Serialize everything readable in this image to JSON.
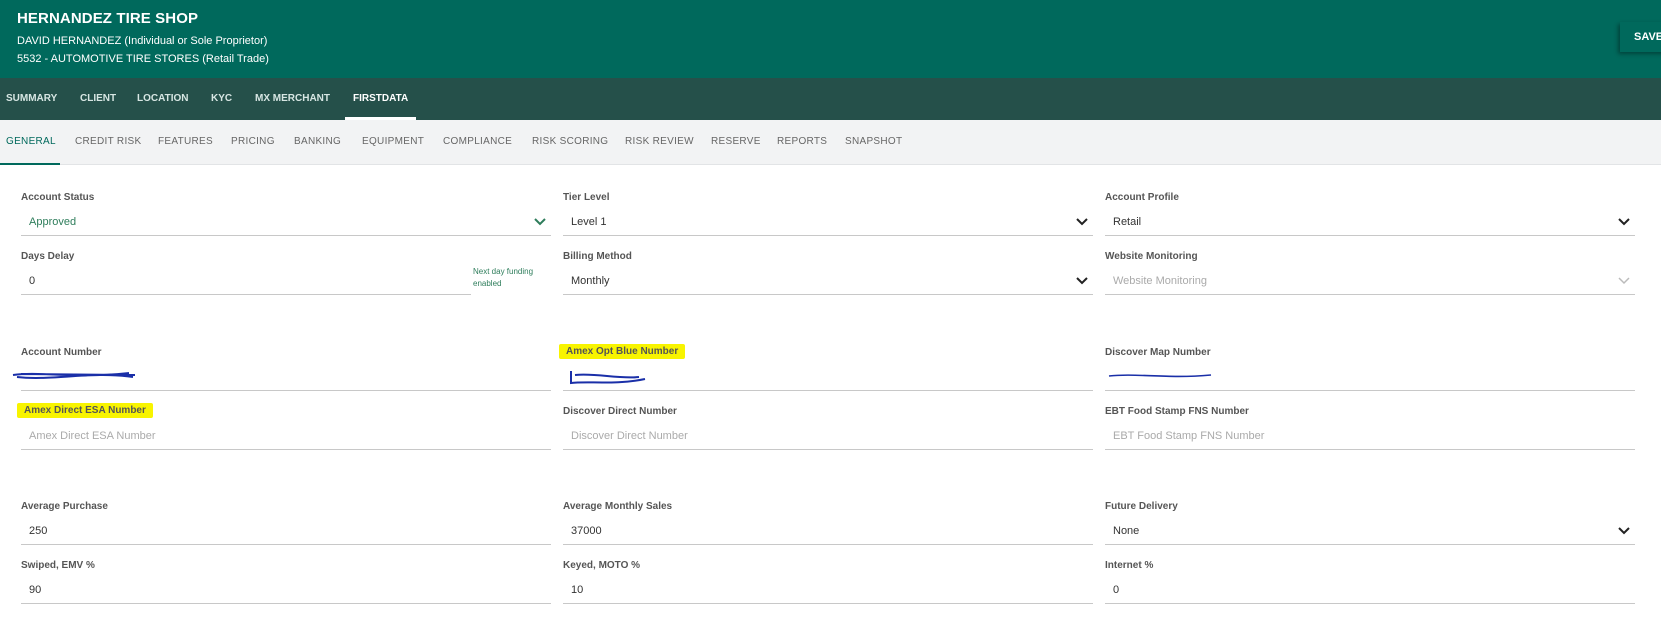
{
  "header": {
    "title": "HERNANDEZ TIRE SHOP",
    "owner": "DAVID HERNANDEZ (Individual or Sole Proprietor)",
    "mcc": "5532 - AUTOMOTIVE TIRE STORES (Retail Trade)",
    "save_label": "SAVE"
  },
  "nav_primary": {
    "tabs": [
      {
        "label": "SUMMARY"
      },
      {
        "label": "CLIENT"
      },
      {
        "label": "LOCATION"
      },
      {
        "label": "KYC"
      },
      {
        "label": "MX MERCHANT"
      },
      {
        "label": "FIRSTDATA"
      }
    ],
    "active": "FIRSTDATA"
  },
  "nav_secondary": {
    "tabs": [
      {
        "label": "GENERAL"
      },
      {
        "label": "CREDIT RISK"
      },
      {
        "label": "FEATURES"
      },
      {
        "label": "PRICING"
      },
      {
        "label": "BANKING"
      },
      {
        "label": "EQUIPMENT"
      },
      {
        "label": "COMPLIANCE"
      },
      {
        "label": "RISK SCORING"
      },
      {
        "label": "RISK REVIEW"
      },
      {
        "label": "RESERVE"
      },
      {
        "label": "REPORTS"
      },
      {
        "label": "SNAPSHOT"
      }
    ],
    "active": "GENERAL"
  },
  "form": {
    "account_status": {
      "label": "Account Status",
      "value": "Approved"
    },
    "tier_level": {
      "label": "Tier Level",
      "value": "Level 1"
    },
    "account_profile": {
      "label": "Account Profile",
      "value": "Retail"
    },
    "days_delay": {
      "label": "Days Delay",
      "value": "0",
      "note": "Next day funding enabled"
    },
    "billing_method": {
      "label": "Billing Method",
      "value": "Monthly"
    },
    "website_monitoring": {
      "label": "Website Monitoring",
      "placeholder": "Website Monitoring"
    },
    "account_number": {
      "label": "Account Number",
      "value": "[redacted]"
    },
    "amex_opt_blue_number": {
      "label": "Amex Opt Blue Number",
      "value": "[redacted]"
    },
    "discover_map_number": {
      "label": "Discover Map Number",
      "value": "[redacted]"
    },
    "amex_direct_esa_number": {
      "label": "Amex Direct ESA Number",
      "placeholder": "Amex Direct ESA Number"
    },
    "discover_direct_number": {
      "label": "Discover Direct Number",
      "placeholder": "Discover Direct Number"
    },
    "ebt_food_stamp_fns_number": {
      "label": "EBT Food Stamp FNS Number",
      "placeholder": "EBT Food Stamp FNS Number"
    },
    "average_purchase": {
      "label": "Average Purchase",
      "value": "250"
    },
    "average_monthly_sales": {
      "label": "Average Monthly Sales",
      "value": "37000"
    },
    "future_delivery": {
      "label": "Future Delivery",
      "value": "None"
    },
    "swiped_emv_pct": {
      "label": "Swiped, EMV %",
      "value": "90"
    },
    "keyed_moto_pct": {
      "label": "Keyed, MOTO %",
      "value": "10"
    },
    "internet_pct": {
      "label": "Internet %",
      "value": "0"
    }
  },
  "colors": {
    "header_bg": "#00695c",
    "nav_primary_bg": "#25504a",
    "nav_secondary_bg": "#f2f3f4",
    "accent": "#00695c",
    "highlight": "#f8f400",
    "redaction_ink": "#1a2fa8"
  }
}
